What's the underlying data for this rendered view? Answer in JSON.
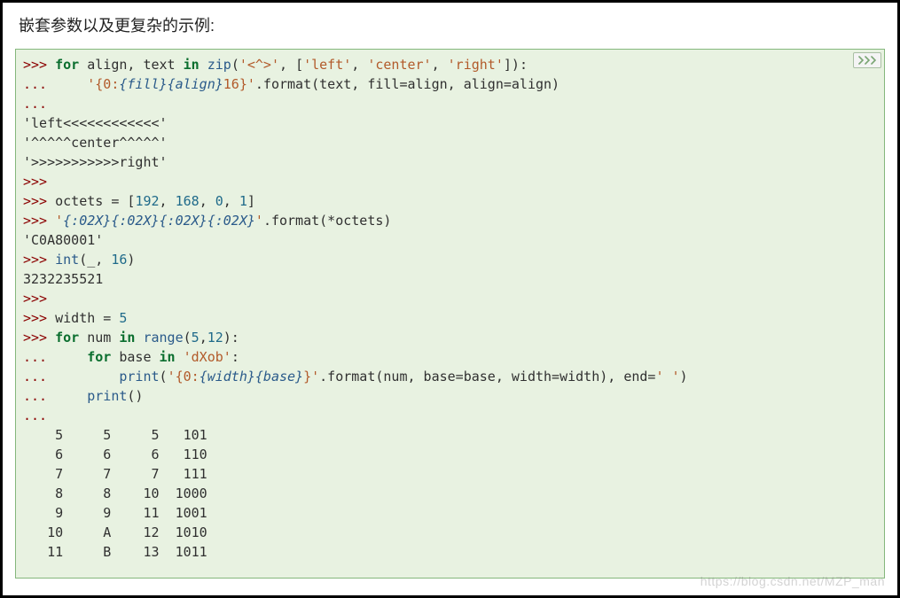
{
  "heading": "嵌套参数以及更复杂的示例:",
  "prompt": ">>>",
  "cont": "...",
  "hide_button": {
    "title": "Hide prompts and output"
  },
  "line_for_zip": {
    "for": "for",
    "names": "align, text",
    "in": "in",
    "zip": "zip",
    "fmtchars": "'<^>'",
    "list_l": "[",
    "left": "'left'",
    "center": "'center'",
    "right": "'right'",
    "list_r": "]",
    "colon": ":"
  },
  "line_fmt1": {
    "str_open": "'{0:",
    "ph_fill": "{fill}",
    "ph_align": "{align}",
    "str_close": "16}'",
    "tail": ".format(text, fill=align, align=align)"
  },
  "out_left": "'left<<<<<<<<<<<<'",
  "out_center": "'^^^^^center^^^^^'",
  "out_right": "'>>>>>>>>>>>right'",
  "line_octets": {
    "lhs": "octets = [",
    "v1": "192",
    "v2": "168",
    "v3": "0",
    "v4": "1",
    "rb": "]"
  },
  "line_hexfmt": {
    "open": "'",
    "p1": "{:02X}",
    "p2": "{:02X}",
    "p3": "{:02X}",
    "p4": "{:02X}",
    "close": "'",
    "tail": ".format(*octets)"
  },
  "out_hex": "'C0A80001'",
  "line_int": {
    "fn": "int",
    "args": "(_, ",
    "sixteen": "16",
    "rp": ")"
  },
  "out_int": "3232235521",
  "line_width": {
    "lhs": "width = ",
    "v": "5"
  },
  "line_for_num": {
    "for": "for",
    "name": "num",
    "in": "in",
    "range": "range",
    "lp": "(",
    "a": "5",
    "comma": ",",
    "b": "12",
    "rp": "):"
  },
  "line_for_base": {
    "for": "for",
    "name": "base",
    "in": "in",
    "s": "'dXob'",
    "colon": ":"
  },
  "line_print": {
    "print": "print",
    "lp": "(",
    "str_open": "'{0:",
    "ph_width": "{width}",
    "ph_base": "{base}",
    "str_close": "}'",
    "mid": ".format(num, base=base, width=width), end=",
    "endstr": "' '",
    "rp": ")"
  },
  "line_print_blank": {
    "print": "print",
    "parens": "()"
  },
  "table": [
    "    5     5     5   101",
    "    6     6     6   110",
    "    7     7     7   111",
    "    8     8    10  1000",
    "    9     9    11  1001",
    "   10     A    12  1010",
    "   11     B    13  1011"
  ],
  "watermark": "https://blog.csdn.net/MZP_man"
}
